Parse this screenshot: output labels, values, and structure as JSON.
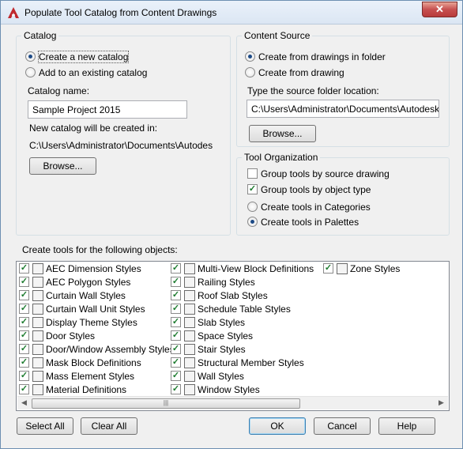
{
  "window": {
    "title": "Populate Tool Catalog from Content Drawings",
    "close_glyph": "✕"
  },
  "catalog": {
    "legend": "Catalog",
    "option_create": "Create a new catalog",
    "option_existing": "Add to an existing catalog",
    "name_label": "Catalog name:",
    "name_value": "Sample Project 2015",
    "created_in_label": "New catalog will be created in:",
    "created_in_path": "C:\\Users\\Administrator\\Documents\\Autodesk\\M",
    "browse_label": "Browse..."
  },
  "content_source": {
    "legend": "Content Source",
    "option_folder": "Create from drawings in folder",
    "option_drawing": "Create from drawing",
    "folder_label": "Type the source folder location:",
    "folder_value": "C:\\Users\\Administrator\\Documents\\Autodesk\\My",
    "browse_label": "Browse..."
  },
  "tool_organization": {
    "legend": "Tool Organization",
    "group_by_source": "Group tools by source drawing",
    "group_by_source_checked": false,
    "group_by_type": "Group tools by object type",
    "group_by_type_checked": true,
    "option_categories": "Create tools in Categories",
    "option_palettes": "Create tools in Palettes"
  },
  "objects": {
    "label": "Create tools for the following objects:",
    "col1": [
      "AEC Dimension Styles",
      "AEC Polygon Styles",
      "Curtain Wall Styles",
      "Curtain Wall Unit Styles",
      "Display Theme Styles",
      "Door Styles",
      "Door/Window Assembly Styles",
      "Mask Block Definitions",
      "Mass Element Styles",
      "Material Definitions"
    ],
    "col2": [
      "Multi-View Block Definitions",
      "Railing Styles",
      "Roof Slab Styles",
      "Schedule Table Styles",
      "Slab Styles",
      "Space Styles",
      "Stair Styles",
      "Structural Member Styles",
      "Wall Styles",
      "Window Styles"
    ],
    "col3": [
      "Zone Styles"
    ],
    "check_glyph": "✓",
    "scroll_grip": "|||"
  },
  "buttons": {
    "select_all": "Select All",
    "clear_all": "Clear All",
    "ok": "OK",
    "cancel": "Cancel",
    "help": "Help"
  },
  "colors": {
    "accent": "#3c7fb1",
    "close": "#c75050",
    "check": "#1c7b2e"
  }
}
